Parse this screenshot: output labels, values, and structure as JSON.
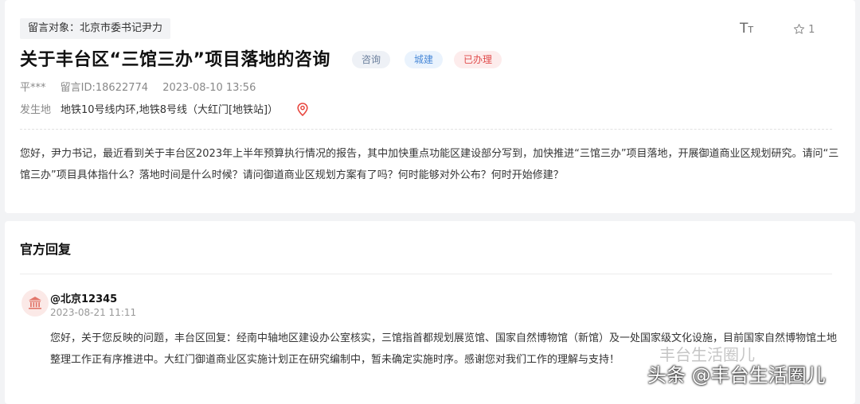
{
  "message": {
    "target": "留言对象：北京市委书记尹力",
    "title": "关于丰台区“三馆三办”项目落地的咨询",
    "tags": [
      {
        "label": "咨询",
        "color": "#6a7f9c"
      },
      {
        "label": "城建",
        "color": "#4b8ad8"
      },
      {
        "label": "已办理",
        "color": "#e04b4b"
      }
    ],
    "font_size_icon": "text-size-icon",
    "favorite_count": "1",
    "author": "平***",
    "message_id": "留言ID:18622774",
    "datetime": "2023-08-10 13:56",
    "location_label": "发生地",
    "location_value": "地铁10号线内环,地铁8号线（大红门[地铁站]）",
    "content": "您好，尹力书记，最近看到关于丰台区2023年上半年预算执行情况的报告，其中加快重点功能区建设部分写到，加快推进“三馆三办”项目落地，开展御道商业区规划研究。请问“三馆三办”项目具体指什么？落地时间是什么时候？请问御道商业区规划方案有了吗？何时能够对外公布？何时开始修建？"
  },
  "reply": {
    "section_title": "官方回复",
    "replier": "@北京12345",
    "time": "2023-08-21 11:11",
    "content": "您好，关于您反映的问题，丰台区回复：经南中轴地区建设办公室核实，三馆指首都规划展览馆、国家自然博物馆（新馆）及一处国家级文化设施，目前国家自然博物馆土地整理工作正有序推进中。大红门御道商业区实施计划正在研究编制中，暂未确定实施时序。感谢您对我们工作的理解与支持！"
  },
  "watermark": {
    "top": "丰台生活圈儿",
    "bottom": "头条 @丰台生活圈儿"
  },
  "colors": {
    "accent_red": "#e04b4b",
    "pin_red": "#e8473f"
  }
}
